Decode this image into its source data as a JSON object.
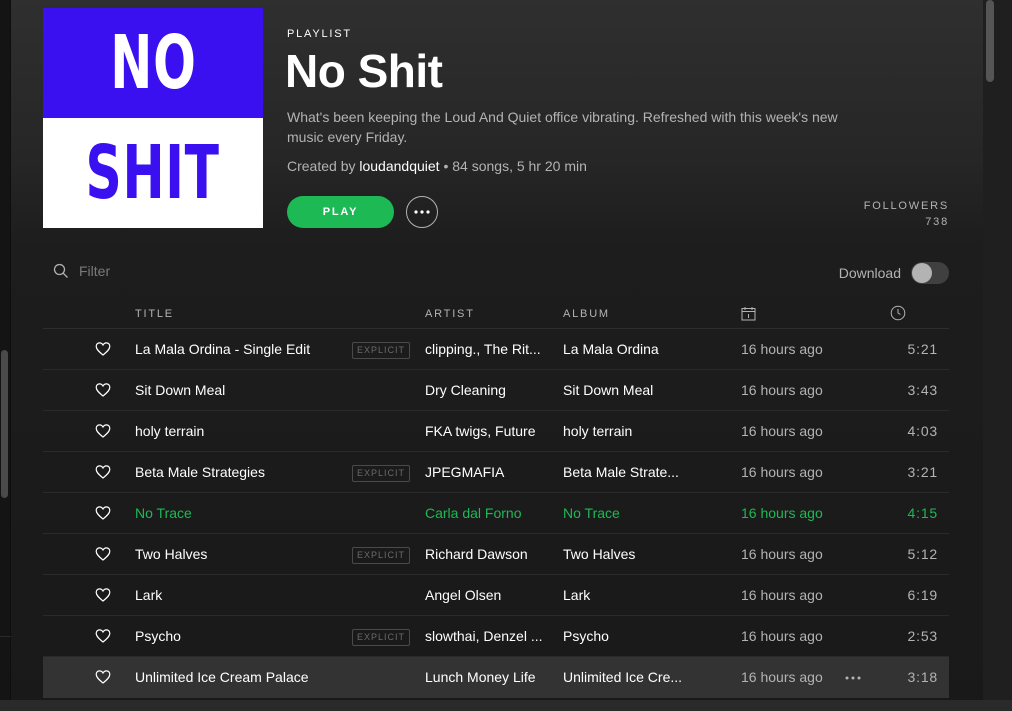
{
  "colors": {
    "accent_green": "#1db954",
    "cover_blue": "#3a0ff0",
    "cover_white": "#ffffff"
  },
  "cover": {
    "top_word": "NO",
    "bottom_word": "SHIT"
  },
  "playlist": {
    "type_label": "PLAYLIST",
    "title": "No Shit",
    "description": "What's been keeping the Loud And Quiet office vibrating. Refreshed with this week's new music every Friday.",
    "created_by_label": "Created by",
    "owner": "loudandquiet",
    "stats": "• 84 songs, 5 hr 20 min",
    "play_label": "PLAY",
    "followers_label": "FOLLOWERS",
    "followers_count": "738"
  },
  "toolbar": {
    "filter_placeholder": "Filter",
    "download_label": "Download",
    "download_on": false
  },
  "table": {
    "columns": {
      "title": "TITLE",
      "artist": "ARTIST",
      "album": "ALBUM",
      "added_icon": "calendar-icon",
      "duration_icon": "clock-icon"
    },
    "explicit_label": "EXPLICIT",
    "tracks": [
      {
        "title": "La Mala Ordina - Single Edit",
        "explicit": true,
        "artist": "clipping., The Rit...",
        "album": "La Mala Ordina",
        "added": "16 hours ago",
        "duration": "5:21"
      },
      {
        "title": "Sit Down Meal",
        "explicit": false,
        "artist": "Dry Cleaning",
        "album": "Sit Down Meal",
        "added": "16 hours ago",
        "duration": "3:43"
      },
      {
        "title": "holy terrain",
        "explicit": false,
        "artist": "FKA twigs, Future",
        "album": "holy terrain",
        "added": "16 hours ago",
        "duration": "4:03"
      },
      {
        "title": "Beta Male Strategies",
        "explicit": true,
        "artist": "JPEGMAFIA",
        "album": "Beta Male Strate...",
        "added": "16 hours ago",
        "duration": "3:21"
      },
      {
        "title": "No Trace",
        "explicit": false,
        "artist": "Carla dal Forno",
        "album": "No Trace",
        "added": "16 hours ago",
        "duration": "4:15",
        "playing": true
      },
      {
        "title": "Two Halves",
        "explicit": true,
        "artist": "Richard Dawson",
        "album": "Two Halves",
        "added": "16 hours ago",
        "duration": "5:12"
      },
      {
        "title": "Lark",
        "explicit": false,
        "artist": "Angel Olsen",
        "album": "Lark",
        "added": "16 hours ago",
        "duration": "6:19"
      },
      {
        "title": "Psycho",
        "explicit": true,
        "artist": "slowthai, Denzel ...",
        "album": "Psycho",
        "added": "16 hours ago",
        "duration": "2:53"
      },
      {
        "title": "Unlimited Ice Cream Palace",
        "explicit": false,
        "artist": "Lunch Money Life",
        "album": "Unlimited Ice Cre...",
        "added": "16 hours ago",
        "duration": "3:18",
        "hover": true
      }
    ]
  }
}
